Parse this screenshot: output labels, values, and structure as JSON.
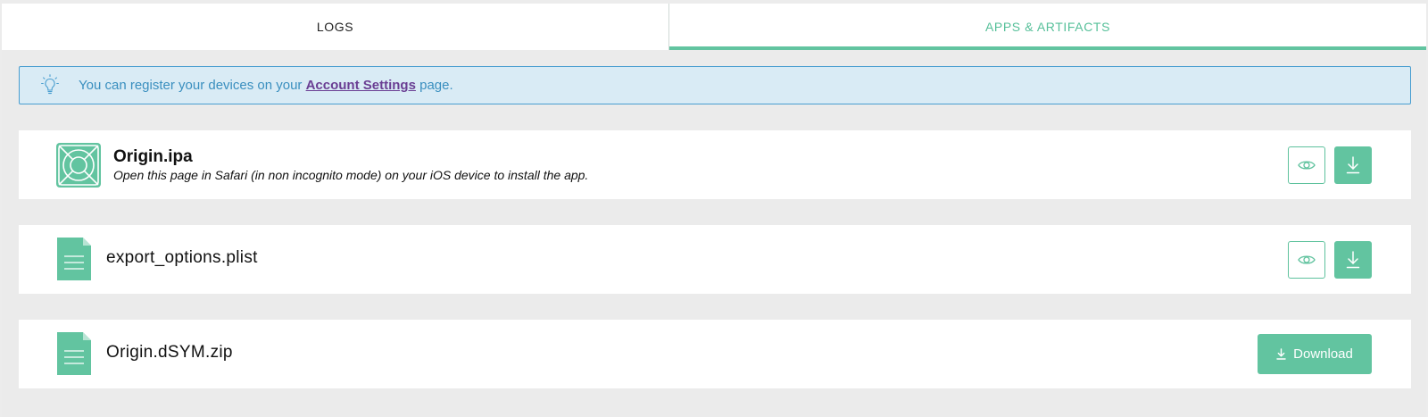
{
  "tabs": {
    "logs": "LOGS",
    "apps": "APPS & ARTIFACTS",
    "active": "apps"
  },
  "notice": {
    "prefix": "You can register your devices on your ",
    "link": "Account Settings",
    "suffix": " page.",
    "icon": "lightbulb-icon"
  },
  "artifacts": [
    {
      "name": "Origin.ipa",
      "description": "Open this page in Safari (in non incognito mode) on your iOS device to install the app.",
      "icon": "ios-app-icon"
    },
    {
      "name": "export_options.plist",
      "icon": "file-icon"
    },
    {
      "name": "Origin.dSYM.zip",
      "icon": "file-icon",
      "download_label": "Download"
    }
  ],
  "colors": {
    "accent": "#62c4a0",
    "notice_bg": "#d9ebf5",
    "notice_border": "#4a9ed0",
    "link": "#6a3e93"
  }
}
